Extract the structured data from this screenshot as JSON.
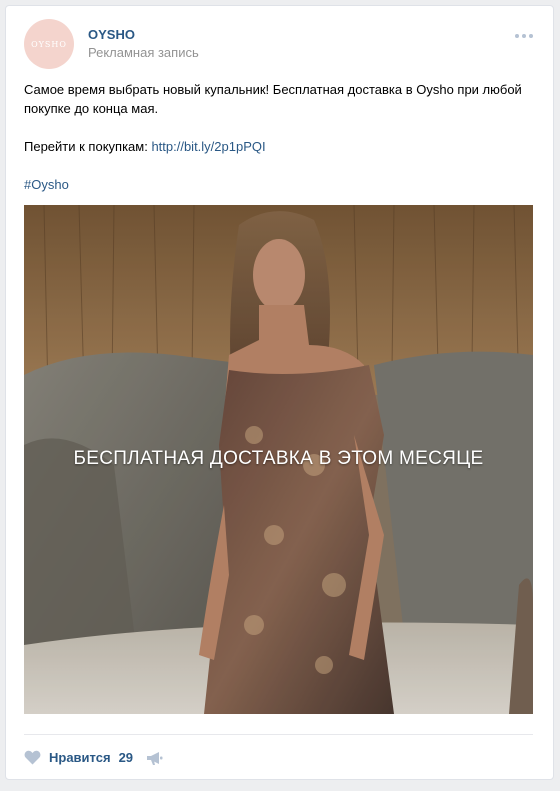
{
  "post": {
    "author": "OYSHO",
    "avatar_text": "OYSHO",
    "subtitle": "Рекламная запись",
    "text_line1": "Самое время выбрать новый купальник! Бесплатная доставка в Oysho при любой покупке до конца мая.",
    "shop_prefix": "Перейти к покупкам: ",
    "shop_link": "http://bit.ly/2p1pPQI",
    "hashtag": "#Oysho",
    "image_overlay_text": "БЕСПЛАТНАЯ ДОСТАВКА В ЭТОМ МЕСЯЦЕ"
  },
  "footer": {
    "like_label": "Нравится",
    "like_count": "29",
    "like_icon": "heart-icon",
    "share_icon": "megaphone-icon"
  },
  "colors": {
    "link": "#2a5885",
    "muted": "#939393",
    "background": "#edeef0",
    "avatar_bg": "#f4d4cd",
    "icon": "#b5c2d3"
  }
}
